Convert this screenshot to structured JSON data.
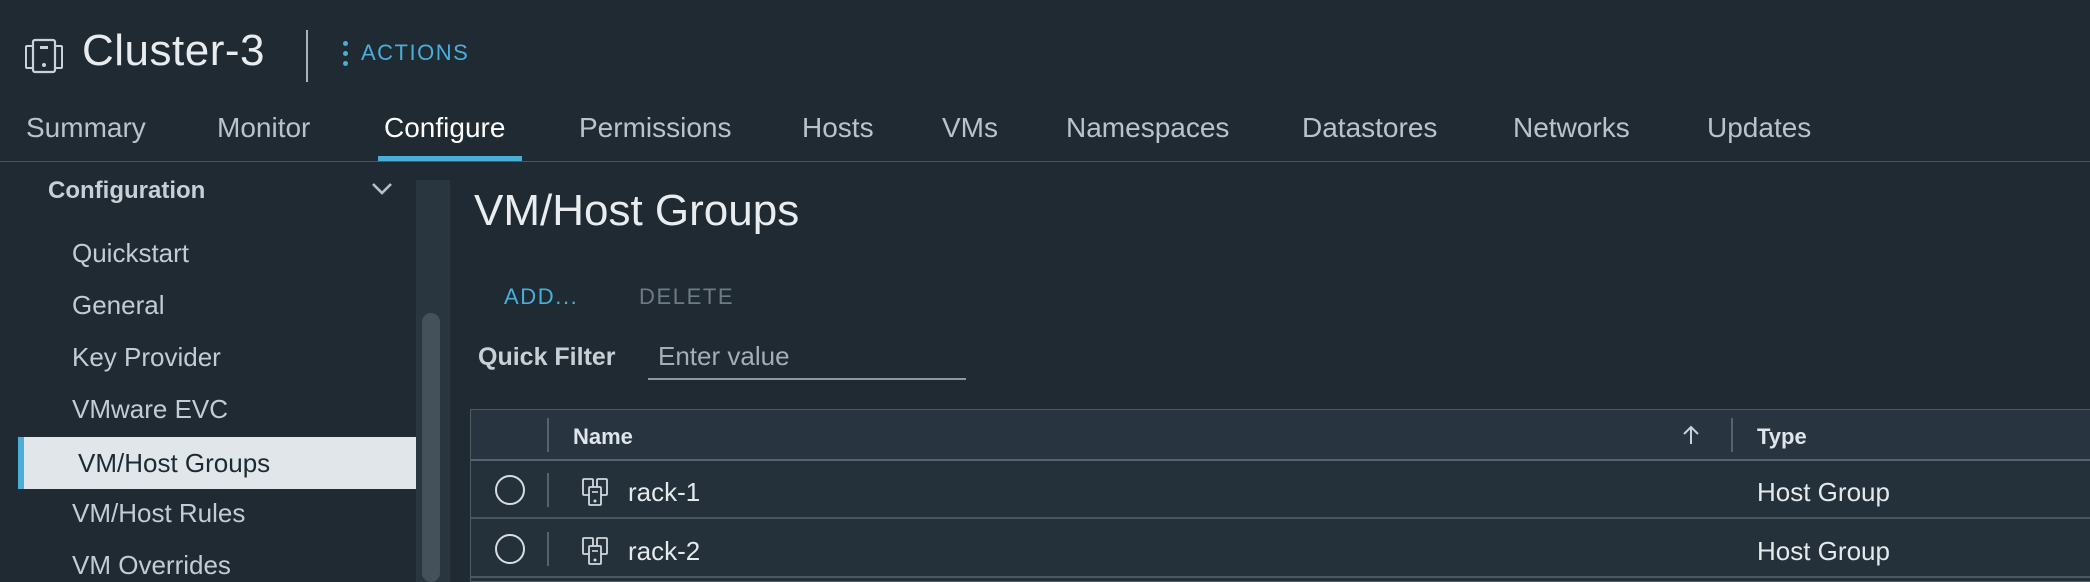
{
  "header": {
    "title": "Cluster-3",
    "actions_label": "ACTIONS",
    "icon": "cluster-icon"
  },
  "tabs": [
    {
      "label": "Summary",
      "active": false
    },
    {
      "label": "Monitor",
      "active": false
    },
    {
      "label": "Configure",
      "active": true
    },
    {
      "label": "Permissions",
      "active": false
    },
    {
      "label": "Hosts",
      "active": false
    },
    {
      "label": "VMs",
      "active": false
    },
    {
      "label": "Namespaces",
      "active": false
    },
    {
      "label": "Datastores",
      "active": false
    },
    {
      "label": "Networks",
      "active": false
    },
    {
      "label": "Updates",
      "active": false
    }
  ],
  "sidebar": {
    "section": "Configuration",
    "items": [
      {
        "label": "Quickstart",
        "active": false
      },
      {
        "label": "General",
        "active": false
      },
      {
        "label": "Key Provider",
        "active": false
      },
      {
        "label": "VMware EVC",
        "active": false
      },
      {
        "label": "VM/Host Groups",
        "active": true
      },
      {
        "label": "VM/Host Rules",
        "active": false
      },
      {
        "label": "VM Overrides",
        "active": false
      }
    ]
  },
  "main": {
    "title": "VM/Host Groups",
    "add_label": "ADD...",
    "delete_label": "DELETE",
    "filter_label": "Quick Filter",
    "filter_placeholder": "Enter value",
    "filter_value": ""
  },
  "table": {
    "columns": [
      "Name",
      "Type"
    ],
    "sort": "ascending",
    "rows": [
      {
        "name": "rack-1",
        "type": "Host Group",
        "icon": "host-group-icon"
      },
      {
        "name": "rack-2",
        "type": "Host Group",
        "icon": "host-group-icon"
      }
    ]
  },
  "colors": {
    "background": "#1f2a33",
    "accent": "#49afd9",
    "active_item_bg": "#e1e6ea"
  }
}
